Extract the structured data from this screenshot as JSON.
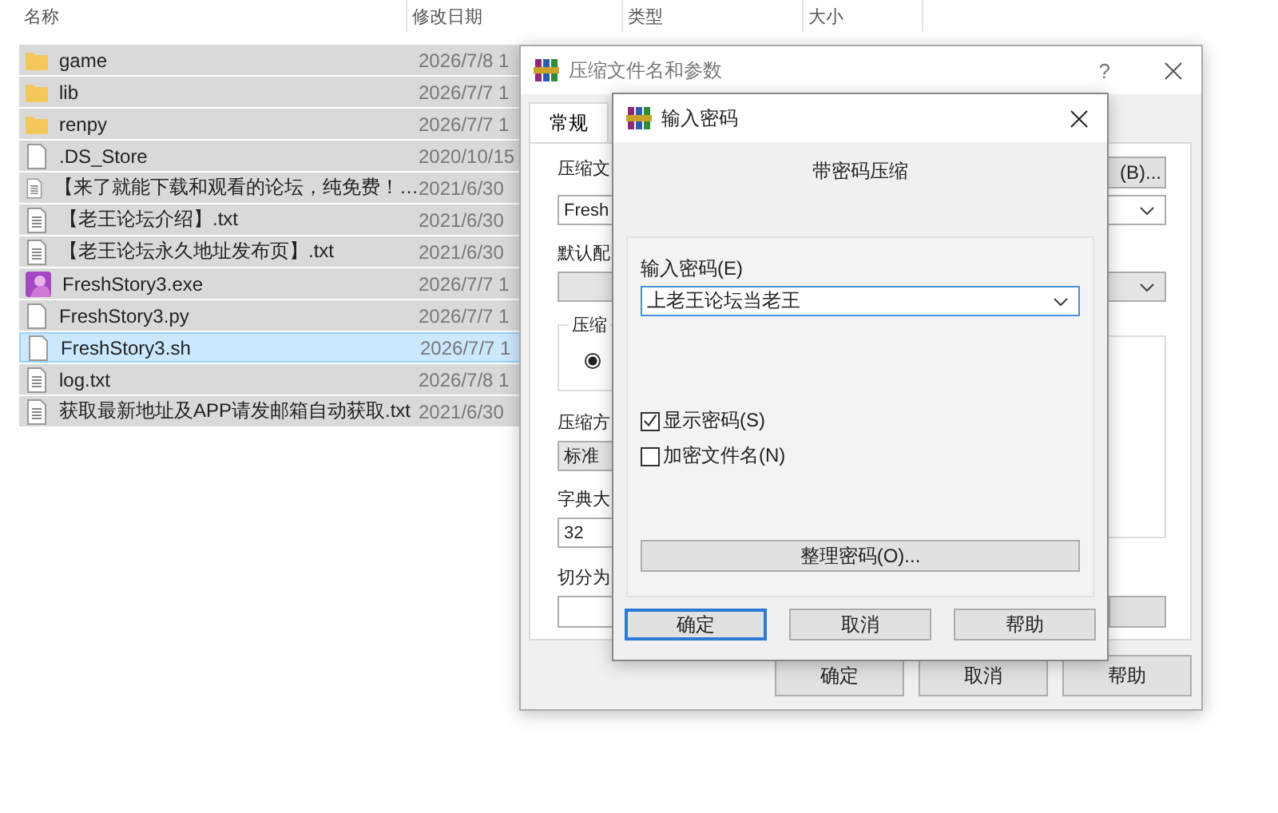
{
  "explorer": {
    "columns": [
      "名称",
      "修改日期",
      "类型",
      "大小"
    ],
    "rows": [
      {
        "name": "game",
        "date": "2026/7/8 1",
        "kind": "folder",
        "selected": true,
        "focused": false
      },
      {
        "name": "lib",
        "date": "2026/7/7 1",
        "kind": "folder",
        "selected": true,
        "focused": false
      },
      {
        "name": "renpy",
        "date": "2026/7/7 1",
        "kind": "folder",
        "selected": true,
        "focused": false
      },
      {
        "name": ".DS_Store",
        "date": "2020/10/15",
        "kind": "blank",
        "selected": true,
        "focused": false
      },
      {
        "name": "【来了就能下载和观看的论坛，纯免费！…",
        "date": "2021/6/30",
        "kind": "text",
        "selected": true,
        "focused": false
      },
      {
        "name": "【老王论坛介绍】.txt",
        "date": "2021/6/30",
        "kind": "text",
        "selected": true,
        "focused": false
      },
      {
        "name": "【老王论坛永久地址发布页】.txt",
        "date": "2021/6/30",
        "kind": "text",
        "selected": true,
        "focused": false
      },
      {
        "name": "FreshStory3.exe",
        "date": "2026/7/7 1",
        "kind": "app",
        "selected": true,
        "focused": false
      },
      {
        "name": "FreshStory3.py",
        "date": "2026/7/7 1",
        "kind": "blank",
        "selected": true,
        "focused": false
      },
      {
        "name": "FreshStory3.sh",
        "date": "2026/7/7 1",
        "kind": "blank",
        "selected": true,
        "focused": true
      },
      {
        "name": "log.txt",
        "date": "2026/7/8 1",
        "kind": "text",
        "selected": true,
        "focused": false
      },
      {
        "name": "获取最新地址及APP请发邮箱自动获取.txt",
        "date": "2021/6/30",
        "kind": "text",
        "selected": true,
        "focused": false
      }
    ]
  },
  "archive_dialog": {
    "title": "压缩文件名和参数",
    "help": "?",
    "tabs": [
      {
        "label": "常规",
        "selected": true
      }
    ],
    "archive_name_label": "压缩文",
    "browse_button": "(B)...",
    "archive_name": "Fresh",
    "profile_label": "默认配",
    "format_group_label": "压缩",
    "format_radio_checked": true,
    "method_label": "压缩方",
    "method": "标准",
    "dictionary_label": "字典大",
    "dictionary": "32",
    "split_label": "切分为",
    "buttons": [
      "确定",
      "取消",
      "帮助"
    ]
  },
  "password_dialog": {
    "title": "输入密码",
    "heading": "带密码压缩",
    "password_label": "输入密码(E)",
    "password": "上老王论坛当老王",
    "options": [
      {
        "label": "显示密码(S)",
        "checked": true
      },
      {
        "label": "加密文件名(N)",
        "checked": false
      }
    ],
    "organize_button": "整理密码(O)...",
    "buttons": [
      {
        "label": "确定",
        "default": true
      },
      {
        "label": "取消",
        "default": false
      },
      {
        "label": "帮助",
        "default": false
      }
    ]
  }
}
